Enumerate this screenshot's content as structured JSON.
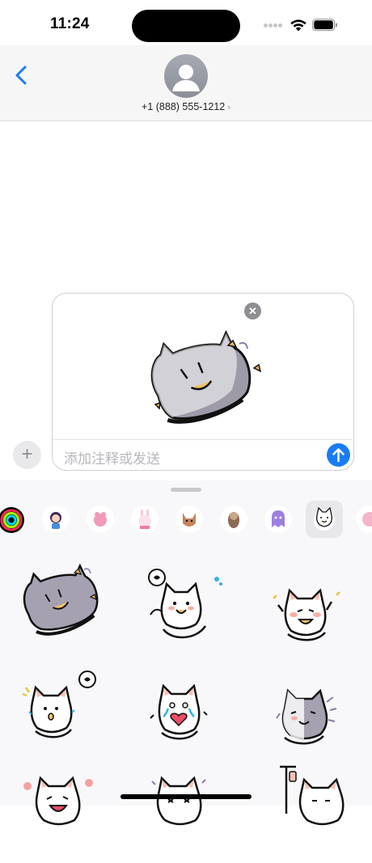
{
  "status_bar": {
    "time": "11:24"
  },
  "header": {
    "contact": "+1 (888) 555-1212",
    "contact_chevron": "›"
  },
  "compose": {
    "placeholder": "添加注释或发送",
    "plus_glyph": "+",
    "remove_glyph": "✕"
  },
  "colors": {
    "accent": "#1a7cf5",
    "header_bg": "#f6f6f6",
    "tray_bg": "#f8f8fa"
  },
  "sticker_pack": {
    "picker_icons": [
      "activity-rings-icon",
      "sticker-pack-girl-icon",
      "sticker-pack-pink-creature-icon",
      "sticker-pack-bunny-icon",
      "sticker-pack-fox-icon",
      "sticker-pack-otter-icon",
      "sticker-pack-ghost-icon",
      "sticker-pack-cat-icon",
      "sticker-pack-pink-icon"
    ],
    "stickers": [
      "gray-cat-flying",
      "white-cat-thinking",
      "white-cat-cheering",
      "white-cat-wondering",
      "white-cat-crying-heart",
      "gray-cat-waving",
      "white-cat-laughing",
      "white-cat-dizzy",
      "white-cat-hospital"
    ]
  }
}
